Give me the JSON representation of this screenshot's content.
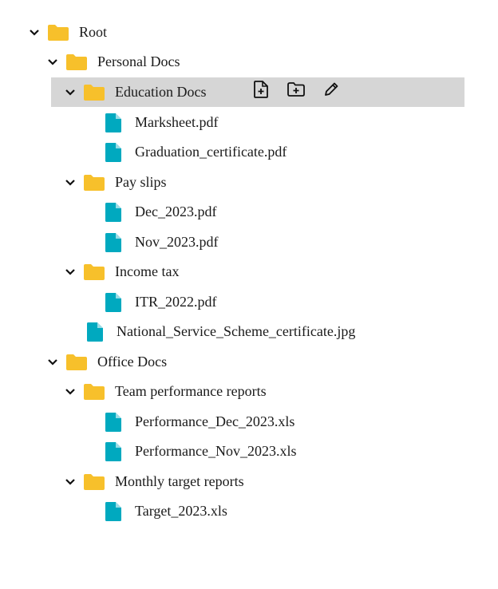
{
  "tree": {
    "root": {
      "label": "Root"
    },
    "personal": {
      "label": "Personal Docs"
    },
    "education": {
      "label": "Education Docs"
    },
    "marksheet": {
      "label": "Marksheet.pdf"
    },
    "graduation": {
      "label": "Graduation_certificate.pdf"
    },
    "payslips": {
      "label": "Pay slips"
    },
    "dec": {
      "label": "Dec_2023.pdf"
    },
    "nov": {
      "label": "Nov_2023.pdf"
    },
    "incometax": {
      "label": "Income tax"
    },
    "itr": {
      "label": "ITR_2022.pdf"
    },
    "nss": {
      "label": "National_Service_Scheme_certificate.jpg"
    },
    "office": {
      "label": "Office Docs"
    },
    "team": {
      "label": "Team performance reports"
    },
    "perfdec": {
      "label": "Performance_Dec_2023.xls"
    },
    "perfnov": {
      "label": "Performance_Nov_2023.xls"
    },
    "monthly": {
      "label": "Monthly target reports"
    },
    "target": {
      "label": "Target_2023.xls"
    }
  },
  "icons": {
    "folder": "folder-icon",
    "file": "file-icon",
    "chevron": "chevron-down-icon",
    "add_file": "add-file-icon",
    "add_folder": "add-folder-icon",
    "rename": "pencil-icon"
  },
  "colors": {
    "folder": "#f7c02b",
    "file": "#00a9bf",
    "selected_bg": "#d6d6d6",
    "text": "#1a1a1a"
  }
}
